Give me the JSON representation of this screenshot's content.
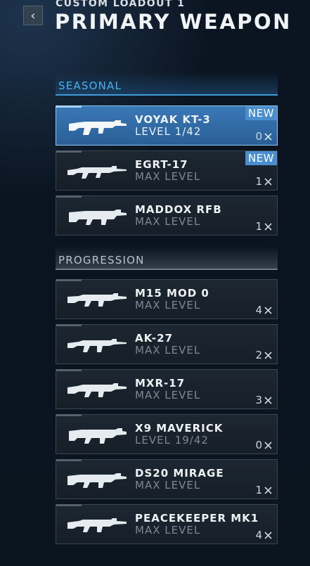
{
  "header": {
    "subtitle": "CUSTOM LOADOUT 1",
    "title": "PRIMARY WEAPON",
    "back_icon": "chevron-left-icon"
  },
  "sections": {
    "seasonal": "SEASONAL",
    "progression": "PROGRESSION"
  },
  "weapons": [
    {
      "name": "VOYAK KT-3",
      "level": "LEVEL 1/42",
      "badge": "NEW",
      "attachments": "0",
      "selected": true
    },
    {
      "name": "EGRT-17",
      "level": "MAX LEVEL",
      "badge": "NEW",
      "attachments": "1"
    },
    {
      "name": "MADDOX RFB",
      "level": "MAX LEVEL",
      "attachments": "1"
    },
    {
      "name": "M15 MOD 0",
      "level": "MAX LEVEL",
      "attachments": "4"
    },
    {
      "name": "AK-27",
      "level": "MAX LEVEL",
      "attachments": "2"
    },
    {
      "name": "MXR-17",
      "level": "MAX LEVEL",
      "attachments": "3"
    },
    {
      "name": "X9 MAVERICK",
      "level": "LEVEL 19/42",
      "attachments": "0"
    },
    {
      "name": "DS20 MIRAGE",
      "level": "MAX LEVEL",
      "attachments": "1"
    },
    {
      "name": "PEACEKEEPER MK1",
      "level": "MAX LEVEL",
      "attachments": "4"
    }
  ],
  "colors": {
    "accent": "#4ab0f0",
    "selected_card": "#3a78b6",
    "new_badge": "#4a8ed0"
  }
}
